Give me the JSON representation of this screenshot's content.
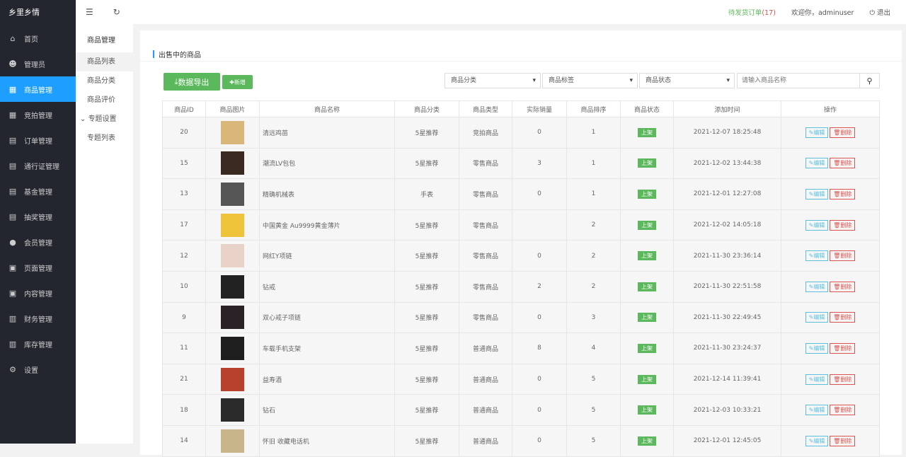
{
  "app": {
    "title": "乡里乡情"
  },
  "sidebar": {
    "items": [
      {
        "label": "首页",
        "icon": "home-icon",
        "glyph": "⌂"
      },
      {
        "label": "管理员",
        "icon": "admin-icon",
        "glyph": "☻"
      },
      {
        "label": "商品管理",
        "icon": "gift-icon",
        "glyph": "▦",
        "active": true
      },
      {
        "label": "竞拍管理",
        "icon": "gift-icon",
        "glyph": "▦"
      },
      {
        "label": "订单管理",
        "icon": "clipboard-icon",
        "glyph": "▤"
      },
      {
        "label": "通行证管理",
        "icon": "clipboard-icon",
        "glyph": "▤"
      },
      {
        "label": "基金管理",
        "icon": "clipboard-icon",
        "glyph": "▤"
      },
      {
        "label": "抽奖管理",
        "icon": "clipboard-icon",
        "glyph": "▤"
      },
      {
        "label": "会员管理",
        "icon": "user-icon",
        "glyph": "●"
      },
      {
        "label": "页面管理",
        "icon": "page-icon",
        "glyph": "▣"
      },
      {
        "label": "内容管理",
        "icon": "page-icon",
        "glyph": "▣"
      },
      {
        "label": "财务管理",
        "icon": "chart-icon",
        "glyph": "▥"
      },
      {
        "label": "库存管理",
        "icon": "chart-icon",
        "glyph": "▥"
      },
      {
        "label": "设置",
        "icon": "gear-icon",
        "glyph": "⚙"
      }
    ]
  },
  "subnav": {
    "title": "商品管理",
    "items": [
      "商品列表",
      "商品分类",
      "商品评价"
    ],
    "group": "专题设置",
    "group_items": [
      "专题列表"
    ]
  },
  "topbar": {
    "pending_label": "待发货订单",
    "pending_count": "(17)",
    "welcome": "欢迎你，adminuser",
    "logout": "退出"
  },
  "main": {
    "title": "出售中的商品",
    "export_label": "数据导出",
    "add_label": "新增",
    "filters": {
      "category": "商品分类",
      "tag": "商品标签",
      "status": "商品状态",
      "search_placeholder": "请输入商品名称"
    },
    "columns": [
      "商品ID",
      "商品图片",
      "商品名称",
      "商品分类",
      "商品类型",
      "实际销量",
      "商品排序",
      "商品状态",
      "添加时间",
      "操作"
    ],
    "edit_label": "编辑",
    "delete_label": "删除",
    "rows": [
      {
        "id": "20",
        "name": "清远鸡苗",
        "cat": "5星推荐",
        "type": "竞拍商品",
        "sales": "0",
        "sort": "1",
        "status": "上架",
        "time": "2021-12-07 18:25:48",
        "color": "#d9b77a"
      },
      {
        "id": "15",
        "name": "潮流LV包包",
        "cat": "5星推荐",
        "type": "零售商品",
        "sales": "3",
        "sort": "1",
        "status": "上架",
        "time": "2021-12-02 13:44:38",
        "color": "#3a2a22"
      },
      {
        "id": "13",
        "name": "精确机械表",
        "cat": "手表",
        "type": "零售商品",
        "sales": "0",
        "sort": "1",
        "status": "上架",
        "time": "2021-12-01 12:27:08",
        "color": "#555"
      },
      {
        "id": "17",
        "name": "中国黄金 Au9999黄金薄片",
        "cat": "5星推荐",
        "type": "零售商品",
        "sales": "",
        "sort": "2",
        "status": "上架",
        "time": "2021-12-02 14:05:18",
        "color": "#f0c43a"
      },
      {
        "id": "12",
        "name": "网红Y项链",
        "cat": "5星推荐",
        "type": "零售商品",
        "sales": "0",
        "sort": "2",
        "status": "上架",
        "time": "2021-11-30 23:36:14",
        "color": "#e8d2c8"
      },
      {
        "id": "10",
        "name": "钻戒",
        "cat": "5星推荐",
        "type": "零售商品",
        "sales": "2",
        "sort": "2",
        "status": "上架",
        "time": "2021-11-30 22:51:58",
        "color": "#222"
      },
      {
        "id": "9",
        "name": "双心戒子项链",
        "cat": "5星推荐",
        "type": "零售商品",
        "sales": "0",
        "sort": "3",
        "status": "上架",
        "time": "2021-11-30 22:49:45",
        "color": "#2a2226"
      },
      {
        "id": "11",
        "name": "车载手机支架",
        "cat": "5星推荐",
        "type": "普通商品",
        "sales": "8",
        "sort": "4",
        "status": "上架",
        "time": "2021-11-30 23:24:37",
        "color": "#1e1e1e"
      },
      {
        "id": "21",
        "name": "益寿酒",
        "cat": "5星推荐",
        "type": "普通商品",
        "sales": "0",
        "sort": "5",
        "status": "上架",
        "time": "2021-12-14 11:39:41",
        "color": "#b8412e"
      },
      {
        "id": "18",
        "name": "钻石",
        "cat": "5星推荐",
        "type": "普通商品",
        "sales": "0",
        "sort": "5",
        "status": "上架",
        "time": "2021-12-03 10:33:21",
        "color": "#2b2b2b"
      },
      {
        "id": "14",
        "name": "怀旧 收藏电话机",
        "cat": "5星推荐",
        "type": "普通商品",
        "sales": "0",
        "sort": "5",
        "status": "上架",
        "time": "2021-12-01 12:45:05",
        "color": "#c9b58a"
      }
    ]
  }
}
